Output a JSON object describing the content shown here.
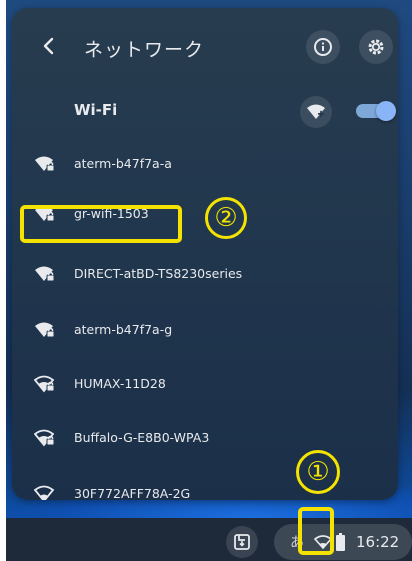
{
  "header": {
    "title": "ネットワーク",
    "back_icon": "chevron-left-icon",
    "info_icon": "info-icon",
    "settings_icon": "gear-icon"
  },
  "wifi": {
    "label": "Wi-Fi",
    "add_network_icon": "wifi-add-icon",
    "toggle_on": true
  },
  "networks": [
    {
      "name": "aterm-b47f7a-a",
      "signal": "full",
      "secured": true
    },
    {
      "name": "gr-wifi-1503",
      "signal": "full",
      "secured": true
    },
    {
      "name": "DIRECT-atBD-TS8230series",
      "signal": "full",
      "secured": true
    },
    {
      "name": "aterm-b47f7a-g",
      "signal": "full",
      "secured": true
    },
    {
      "name": "HUMAX-11D28",
      "signal": "weak",
      "secured": true
    },
    {
      "name": "Buffalo-G-E8B0-WPA3",
      "signal": "weak",
      "secured": true
    },
    {
      "name": "30F772AFF78A-2G",
      "signal": "weak",
      "secured": false
    }
  ],
  "shelf": {
    "holding_space_icon": "holding-space-icon",
    "ime_label": "あ",
    "tray_wifi_icon": "wifi-outline-icon",
    "battery_icon": "battery-icon",
    "clock": "16:22"
  },
  "annotations": {
    "marker_1": "①",
    "marker_2": "②",
    "highlight_color": "#f4e300"
  },
  "colors": {
    "panel_bg": "#21374d",
    "accent": "#8ab4f8",
    "text": "#e8eaed",
    "shelf_bg": "#1e2a3a"
  }
}
